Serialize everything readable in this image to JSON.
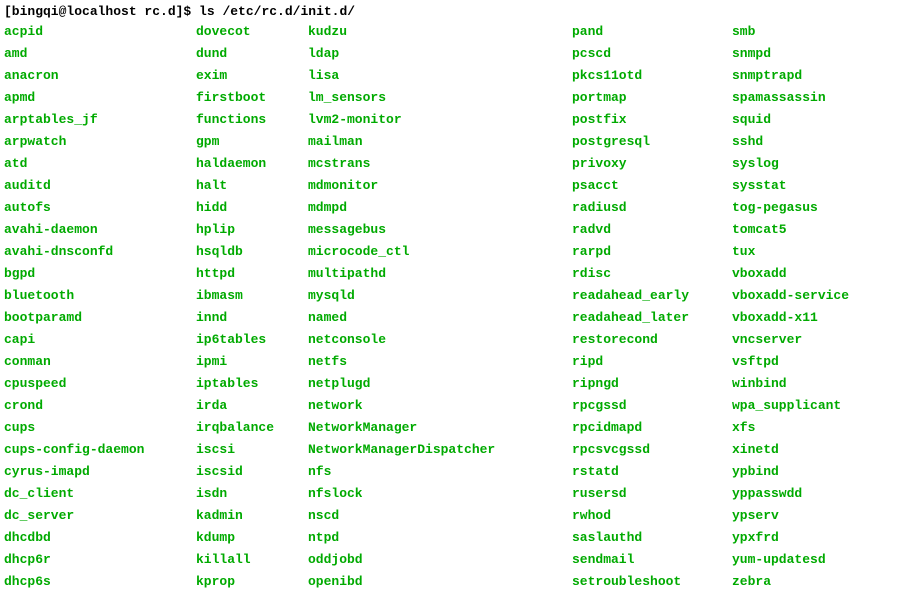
{
  "prompt": {
    "user_host": "[bingqi@localhost rc.d]$ ",
    "command": "ls /etc/rc.d/init.d/"
  },
  "columns": [
    [
      "acpid",
      "amd",
      "anacron",
      "apmd",
      "arptables_jf",
      "arpwatch",
      "atd",
      "auditd",
      "autofs",
      "avahi-daemon",
      "avahi-dnsconfd",
      "bgpd",
      "bluetooth",
      "bootparamd",
      "capi",
      "conman",
      "cpuspeed",
      "crond",
      "cups",
      "cups-config-daemon",
      "cyrus-imapd",
      "dc_client",
      "dc_server",
      "dhcdbd",
      "dhcp6r",
      "dhcp6s"
    ],
    [
      "dovecot",
      "dund",
      "exim",
      "firstboot",
      "functions",
      "gpm",
      "haldaemon",
      "halt",
      "hidd",
      "hplip",
      "hsqldb",
      "httpd",
      "ibmasm",
      "innd",
      "ip6tables",
      "ipmi",
      "iptables",
      "irda",
      "irqbalance",
      "iscsi",
      "iscsid",
      "isdn",
      "kadmin",
      "kdump",
      "killall",
      "kprop"
    ],
    [
      "kudzu",
      "ldap",
      "lisa",
      "lm_sensors",
      "lvm2-monitor",
      "mailman",
      "mcstrans",
      "mdmonitor",
      "mdmpd",
      "messagebus",
      "microcode_ctl",
      "multipathd",
      "mysqld",
      "named",
      "netconsole",
      "netfs",
      "netplugd",
      "network",
      "NetworkManager",
      "NetworkManagerDispatcher",
      "nfs",
      "nfslock",
      "nscd",
      "ntpd",
      "oddjobd",
      "openibd"
    ],
    [
      "pand",
      "pcscd",
      "pkcs11otd",
      "portmap",
      "postfix",
      "postgresql",
      "privoxy",
      "psacct",
      "radiusd",
      "radvd",
      "rarpd",
      "rdisc",
      "readahead_early",
      "readahead_later",
      "restorecond",
      "ripd",
      "ripngd",
      "rpcgssd",
      "rpcidmapd",
      "rpcsvcgssd",
      "rstatd",
      "rusersd",
      "rwhod",
      "saslauthd",
      "sendmail",
      "setroubleshoot"
    ],
    [
      "smb",
      "snmpd",
      "snmptrapd",
      "spamassassin",
      "squid",
      "sshd",
      "syslog",
      "sysstat",
      "tog-pegasus",
      "tomcat5",
      "tux",
      "vboxadd",
      "vboxadd-service",
      "vboxadd-x11",
      "vncserver",
      "vsftpd",
      "winbind",
      "wpa_supplicant",
      "xfs",
      "xinetd",
      "ypbind",
      "yppasswdd",
      "ypserv",
      "ypxfrd",
      "yum-updatesd",
      "zebra"
    ]
  ]
}
